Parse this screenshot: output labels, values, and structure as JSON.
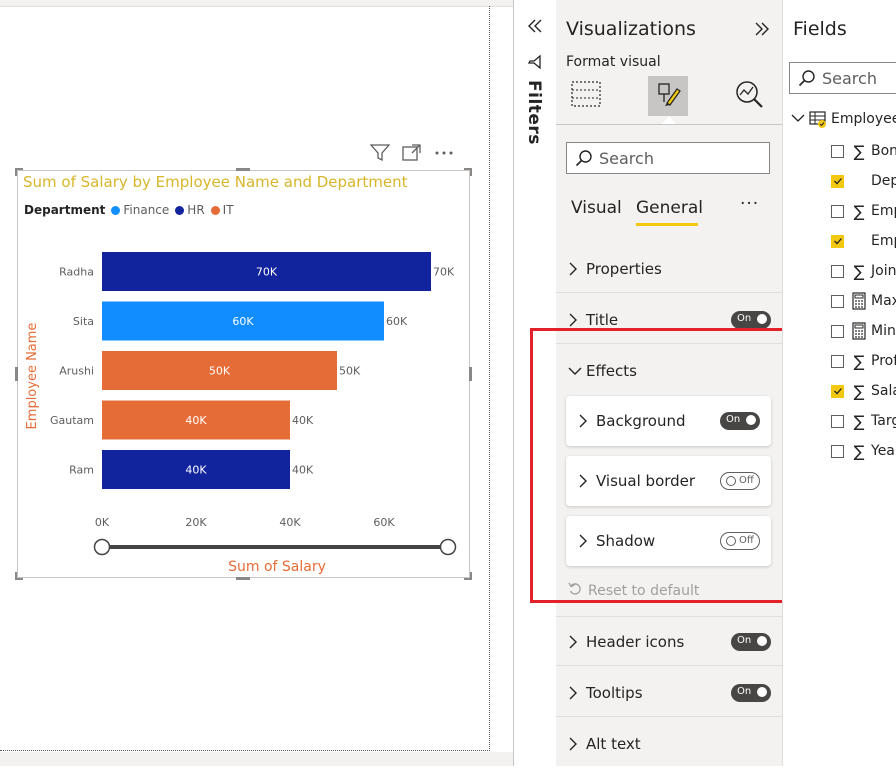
{
  "chart": {
    "title": "Sum of Salary by Employee Name and Department",
    "legend_title": "Department",
    "legend": [
      {
        "name": "Finance",
        "color": "#118dff"
      },
      {
        "name": "HR",
        "color": "#12239e"
      },
      {
        "name": "IT",
        "color": "#e66c37"
      }
    ]
  },
  "chart_data": {
    "type": "bar",
    "orientation": "horizontal",
    "title": "Sum of Salary by Employee Name and Department",
    "xlabel": "Sum of Salary",
    "ylabel": "Employee Name",
    "xlim": [
      0,
      70000
    ],
    "x_ticks": [
      "0K",
      "20K",
      "40K",
      "60K"
    ],
    "x_tick_values": [
      0,
      20000,
      40000,
      60000
    ],
    "categories": [
      "Radha",
      "Sita",
      "Arushi",
      "Gautam",
      "Ram"
    ],
    "values": [
      70000,
      60000,
      50000,
      40000,
      40000
    ],
    "value_labels": [
      "70K",
      "60K",
      "50K",
      "40K",
      "40K"
    ],
    "departments": [
      "HR",
      "Finance",
      "IT",
      "IT",
      "HR"
    ],
    "bar_colors": [
      "#12239e",
      "#118dff",
      "#e66c37",
      "#e66c37",
      "#12239e"
    ],
    "legend_position": "top-left",
    "grid": false
  },
  "filters": {
    "label": "Filters",
    "collapse_icon": "chevrons-left-icon"
  },
  "viz": {
    "title": "Visualizations",
    "format_label": "Format visual",
    "search_placeholder": "Search",
    "tab_visual": "Visual",
    "tab_general": "General",
    "more": "···",
    "sections": {
      "properties": "Properties",
      "title": "Title",
      "effects": "Effects",
      "header_icons": "Header icons",
      "tooltips": "Tooltips",
      "alt_text": "Alt text"
    },
    "cards": {
      "background": "Background",
      "visual_border": "Visual border",
      "shadow": "Shadow"
    },
    "toggle_on": "On",
    "toggle_off": "Off",
    "reset": "Reset to default"
  },
  "fields": {
    "title": "Fields",
    "search_placeholder": "Search",
    "table_name": "Employee",
    "items": [
      {
        "name": "Bonus",
        "checked": false,
        "icon": "sigma"
      },
      {
        "name": "Department",
        "checked": true,
        "icon": "none"
      },
      {
        "name": "Employee ID",
        "checked": false,
        "icon": "sigma"
      },
      {
        "name": "Employee Name",
        "checked": true,
        "icon": "none"
      },
      {
        "name": "Joining Year",
        "checked": false,
        "icon": "sigma"
      },
      {
        "name": "Max Salary",
        "checked": false,
        "icon": "calculator"
      },
      {
        "name": "Min Salary",
        "checked": false,
        "icon": "calculator"
      },
      {
        "name": "Profit",
        "checked": false,
        "icon": "sigma"
      },
      {
        "name": "Salary",
        "checked": true,
        "icon": "sigma"
      },
      {
        "name": "Target",
        "checked": false,
        "icon": "sigma"
      },
      {
        "name": "Year",
        "checked": false,
        "icon": "sigma"
      }
    ]
  }
}
